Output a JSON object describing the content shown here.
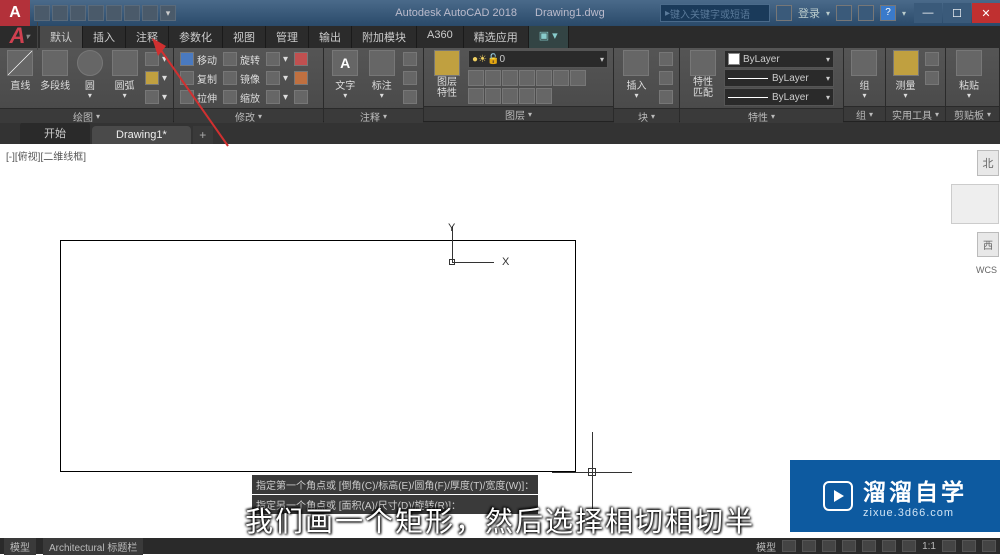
{
  "title": {
    "app": "Autodesk AutoCAD 2018",
    "file": "Drawing1.dwg"
  },
  "search_placeholder": "键入关键字或短语",
  "user": {
    "label": "登录"
  },
  "menu_tabs": [
    "默认",
    "插入",
    "注释",
    "参数化",
    "视图",
    "管理",
    "输出",
    "附加模块",
    "A360",
    "精选应用"
  ],
  "ribbon": {
    "draw": {
      "title": "绘图",
      "line": "直线",
      "polyline": "多段线",
      "circle": "圆",
      "arc": "圆弧"
    },
    "modify": {
      "title": "修改",
      "move": "移动",
      "rotate": "旋转",
      "copy": "复制",
      "mirror": "镜像",
      "stretch": "拉伸",
      "scale": "缩放"
    },
    "annot": {
      "title": "注释",
      "text": "文字",
      "dim": "标注"
    },
    "layer": {
      "title": "图层",
      "props": "图层\n特性"
    },
    "block": {
      "title": "块",
      "insert": "插入"
    },
    "props": {
      "title": "特性",
      "btn": "特性\n匹配",
      "bylayer": "ByLayer"
    },
    "group": {
      "title": "组",
      "btn": "组"
    },
    "util": {
      "title": "实用工具",
      "btn": "测量"
    },
    "clip": {
      "title": "剪贴板",
      "btn": "粘贴"
    }
  },
  "file_tabs": {
    "start": "开始",
    "drawing": "Drawing1*"
  },
  "viewport_label": "[-][俯视][二维线框]",
  "ucs": {
    "x": "X",
    "y": "Y"
  },
  "nav": {
    "north": "北",
    "east": "西",
    "wcs": "WCS"
  },
  "cmd": {
    "l1": "指定第一个角点或 [倒角(C)/标高(E)/圆角(F)/厚度(T)/宽度(W)]：",
    "l2": "指定另一个角点或 [面积(A)/尺寸(D)/旋转(R)]："
  },
  "subtitle": "我们画一个矩形，然后选择相切相切半",
  "watermark": {
    "brand": "溜溜自学",
    "url": "zixue.3d66.com"
  },
  "status": {
    "model": "模型",
    "arch": "Architectural 标题栏",
    "scale": "1:1"
  }
}
